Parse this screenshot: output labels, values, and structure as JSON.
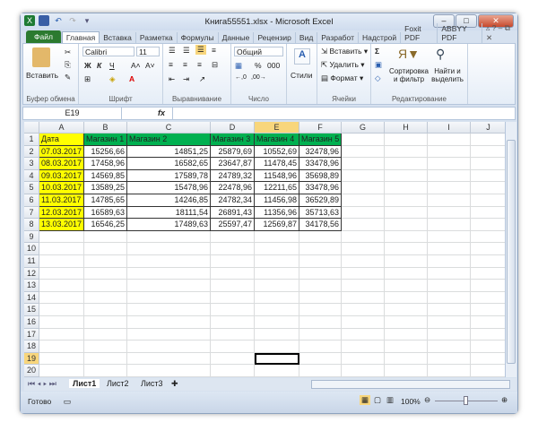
{
  "title": "Книга55551.xlsx - Microsoft Excel",
  "tabs": [
    "Файл",
    "Главная",
    "Вставка",
    "Разметка",
    "Формулы",
    "Данные",
    "Рецензир",
    "Вид",
    "Разработ",
    "Надстрой",
    "Foxit PDF",
    "ABBYY PDF"
  ],
  "active_tab": "Главная",
  "ribbon": {
    "clipboard": {
      "paste": "Вставить",
      "label": "Буфер обмена"
    },
    "font": {
      "name": "Calibri",
      "size": "11",
      "bold": "Ж",
      "italic": "К",
      "underline": "Ч",
      "label": "Шрифт"
    },
    "alignment": {
      "label": "Выравнивание"
    },
    "number": {
      "format": "Общий",
      "percent": "%",
      "thousands": "000",
      "label": "Число"
    },
    "styles": {
      "button": "Стили"
    },
    "cells": {
      "insert": "Вставить",
      "delete": "Удалить",
      "format": "Формат",
      "label": "Ячейки"
    },
    "editing": {
      "sort": "Сортировка и фильтр",
      "find": "Найти и выделить",
      "label": "Редактирование",
      "sum": "Σ"
    }
  },
  "formula_bar": {
    "name_box": "E19",
    "fx": "fx",
    "value": ""
  },
  "columns": [
    "A",
    "B",
    "C",
    "D",
    "E",
    "F",
    "G",
    "H",
    "I",
    "J"
  ],
  "selected_cell": "E19",
  "rows_count": 20,
  "table": {
    "headers": [
      "Дата",
      "Магазин 1",
      "Магазин 2",
      "Магазин 3",
      "Магазин 4",
      "Магазин 5"
    ],
    "rows": [
      [
        "07.03.2017",
        "15256,66",
        "14851,25",
        "25879,69",
        "10552,69",
        "32478,96"
      ],
      [
        "08.03.2017",
        "17458,96",
        "16582,65",
        "23647,87",
        "11478,45",
        "33478,96"
      ],
      [
        "09.03.2017",
        "14569,85",
        "17589,78",
        "24789,32",
        "11548,96",
        "35698,89"
      ],
      [
        "10.03.2017",
        "13589,25",
        "15478,96",
        "22478,96",
        "12211,65",
        "33478,96"
      ],
      [
        "11.03.2017",
        "14785,65",
        "14246,85",
        "24782,34",
        "11456,98",
        "36529,89"
      ],
      [
        "12.03.2017",
        "16589,63",
        "18111,54",
        "26891,43",
        "11356,96",
        "35713,63"
      ],
      [
        "13.03.2017",
        "16546,25",
        "17489,63",
        "25597,47",
        "12569,87",
        "34178,56"
      ]
    ]
  },
  "colors": {
    "date_fill": "#ffff00",
    "header_fill": "#00b050",
    "file_tab": "#2b7a2f"
  },
  "sheet_tabs": [
    "Лист1",
    "Лист2",
    "Лист3"
  ],
  "active_sheet": "Лист1",
  "status": {
    "ready": "Готово",
    "zoom": "100%"
  }
}
